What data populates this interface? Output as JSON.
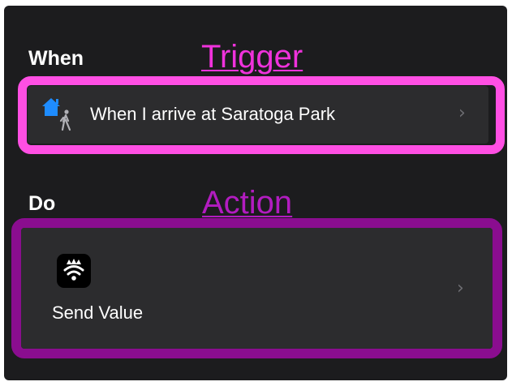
{
  "when": {
    "label": "When",
    "annotation": "Trigger",
    "trigger_text": "When I arrive at Saratoga Park",
    "icon": "home-arrive-icon"
  },
  "do": {
    "label": "Do",
    "annotation": "Action",
    "action_text": "Send Value",
    "icon": "broadcast-app-icon"
  },
  "colors": {
    "panel_bg": "#1c1c1e",
    "row_bg": "#2c2c2e",
    "trigger_highlight": "#ff4fe3",
    "action_highlight": "#8a0d8f",
    "annotation_text": "#c21fc8",
    "home_icon_blue": "#1e8cff"
  }
}
